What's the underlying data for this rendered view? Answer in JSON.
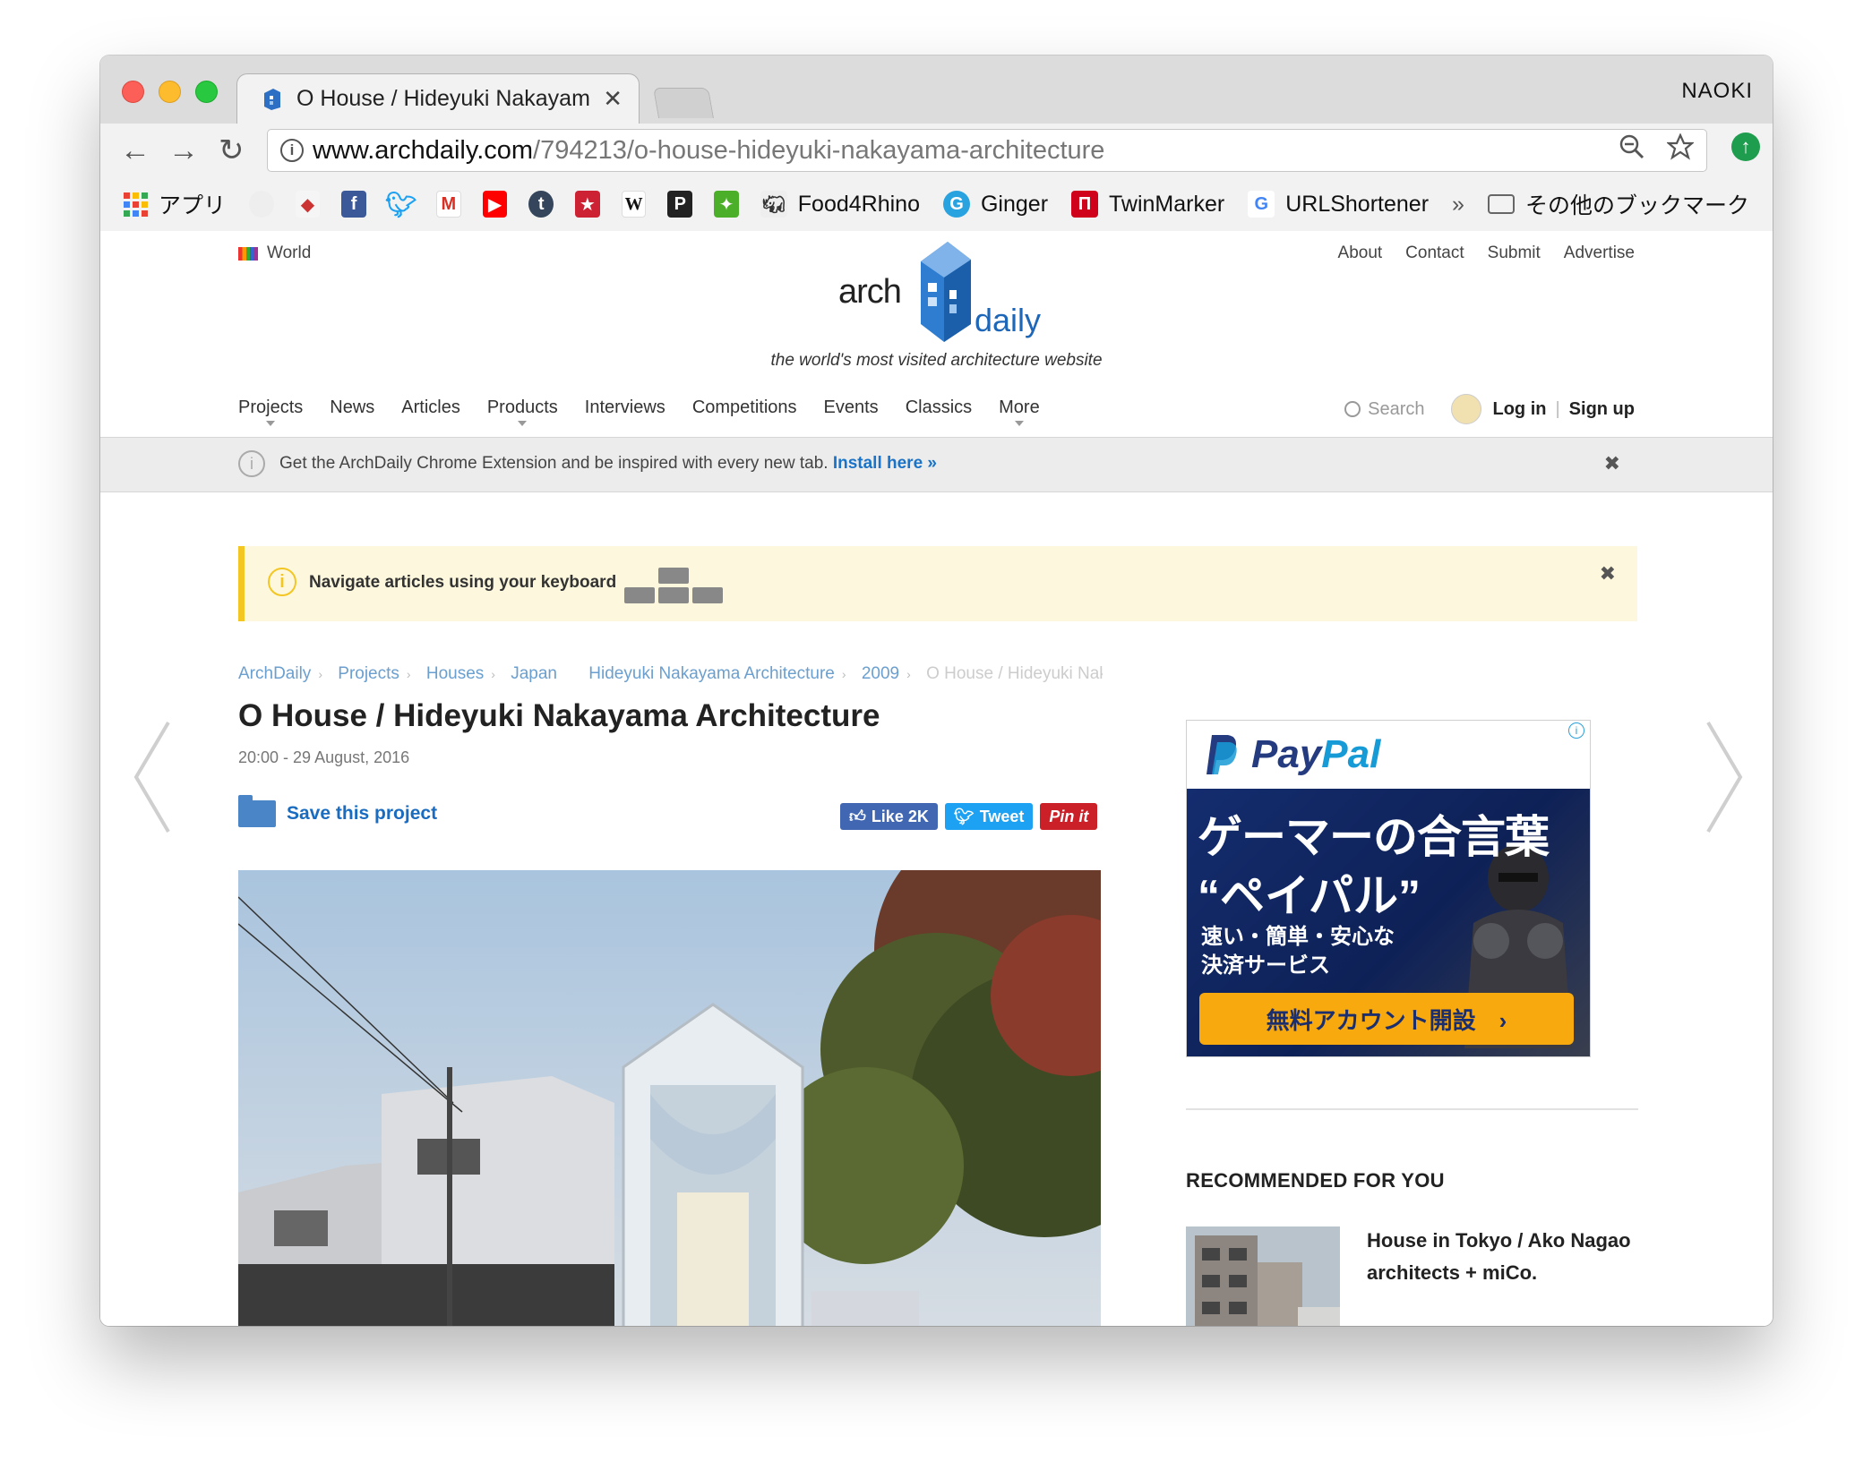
{
  "browser": {
    "tab_title": "O House / Hideyuki Nakayama Architecture",
    "tab_close": "✕",
    "profile_name": "NAOKI",
    "url_domain": "www.archdaily.com",
    "url_path": "/794213/o-house-hideyuki-nakayama-architecture",
    "bookmarks": {
      "apps": "アプリ",
      "food4rhino": "Food4Rhino",
      "ginger": "Ginger",
      "twinmarker": "TwinMarker",
      "urlshortener": "URLShortener",
      "overflow": "»",
      "other": "その他のブックマーク"
    }
  },
  "site": {
    "region": "World",
    "top_links": [
      "About",
      "Contact",
      "Submit",
      "Advertise"
    ],
    "logo_left": "arch",
    "logo_right": "daily",
    "tagline": "the world's most visited architecture website",
    "nav": [
      "Projects",
      "News",
      "Articles",
      "Products",
      "Interviews",
      "Competitions",
      "Events",
      "Classics",
      "More"
    ],
    "search_label": "Search",
    "login": "Log in",
    "signup": "Sign up",
    "sep": "|"
  },
  "ext_banner": {
    "text": "Get the ArchDaily Chrome Extension and be inspired with every new tab.",
    "link": "Install here »",
    "close": "✖"
  },
  "kbd_banner": {
    "text": "Navigate articles using your keyboard",
    "close": "✖"
  },
  "article": {
    "breadcrumbs": [
      "ArchDaily",
      "Projects",
      "Houses",
      "Japan",
      "Hideyuki Nakayama Architecture",
      "2009",
      "O House / Hideyuki Nak"
    ],
    "title": "O House / Hideyuki Nakayama Architecture",
    "date": "20:00 - 29 August, 2016",
    "save_label": "Save this project",
    "like_label": "Like 2K",
    "tweet_label": "Tweet",
    "pin_label": "Pin it"
  },
  "ad": {
    "brand_a": "Pay",
    "brand_b": "Pal",
    "headline_1": "ゲーマーの合言葉",
    "headline_2": "“ペイパル”",
    "sub_1": "速い・簡単・安心な",
    "sub_2": "決済サービス",
    "cta": "無料アカウント開設　›"
  },
  "recommended": {
    "heading": "RECOMMENDED FOR YOU",
    "items": [
      {
        "title": "House in Tokyo / Ako Nagao architects + miCo."
      }
    ]
  },
  "colors": {
    "link_blue": "#1a73c7",
    "banner_yellow": "#fdf8dd",
    "banner_accent": "#f3c623",
    "paypal_dark": "#253b80",
    "paypal_light": "#179bd7"
  }
}
